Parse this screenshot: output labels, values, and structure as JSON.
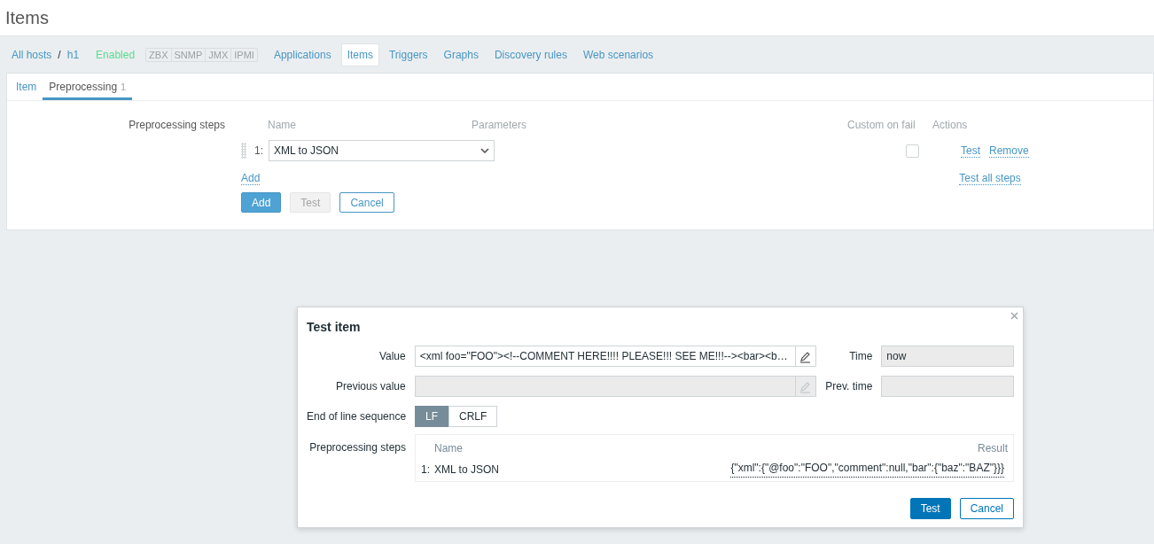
{
  "page_title": "Items",
  "breadcrumbs": {
    "items": [
      {
        "label": "All hosts"
      },
      {
        "label": "h1"
      }
    ],
    "separator": "/"
  },
  "host_status": "Enabled",
  "availability": [
    {
      "label": "ZBX"
    },
    {
      "label": "SNMP"
    },
    {
      "label": "JMX"
    },
    {
      "label": "IPMI"
    }
  ],
  "nav_tabs": [
    {
      "label": "Applications",
      "selected": false
    },
    {
      "label": "Items",
      "selected": true
    },
    {
      "label": "Triggers",
      "selected": false
    },
    {
      "label": "Graphs",
      "selected": false
    },
    {
      "label": "Discovery rules",
      "selected": false
    },
    {
      "label": "Web scenarios",
      "selected": false
    }
  ],
  "form_tabs": [
    {
      "label": "Item",
      "selected": false
    },
    {
      "label": "Preprocessing",
      "count": "1",
      "selected": true
    }
  ],
  "preprocessing": {
    "label": "Preprocessing steps",
    "columns": [
      "Name",
      "Parameters",
      "Custom on fail",
      "Actions"
    ],
    "steps": [
      {
        "number": "1:",
        "name": "XML to JSON",
        "custom_on_fail": false,
        "actions": [
          "Test",
          "Remove"
        ]
      }
    ],
    "add_link": "Add",
    "test_all_link": "Test all steps"
  },
  "buttons": [
    {
      "label": "Add",
      "kind": "primary"
    },
    {
      "label": "Test",
      "kind": "disabled"
    },
    {
      "label": "Cancel",
      "kind": "secondary"
    }
  ],
  "dialog": {
    "title": "Test item",
    "value_label": "Value",
    "value": "<xml foo=\"FOO\"><!--COMMENT HERE!!!! PLEASE!!! SEE ME!!!--><bar><b…",
    "time_label": "Time",
    "time": "now",
    "prev_value_label": "Previous value",
    "prev_time_label": "Prev. time",
    "eol_label": "End of line sequence",
    "eol_options": [
      {
        "label": "LF",
        "selected": true
      },
      {
        "label": "CRLF",
        "selected": false
      }
    ],
    "steps_label": "Preprocessing steps",
    "steps_columns": [
      "Name",
      "Result"
    ],
    "steps": [
      {
        "number": "1:",
        "name": "XML to JSON",
        "result": "{\"xml\":{\"@foo\":\"FOO\",\"comment\":null,\"bar\":{\"baz\":\"BAZ\"}}}"
      }
    ],
    "buttons": [
      {
        "label": "Test",
        "kind": "primary"
      },
      {
        "label": "Cancel",
        "kind": "secondary"
      }
    ]
  }
}
